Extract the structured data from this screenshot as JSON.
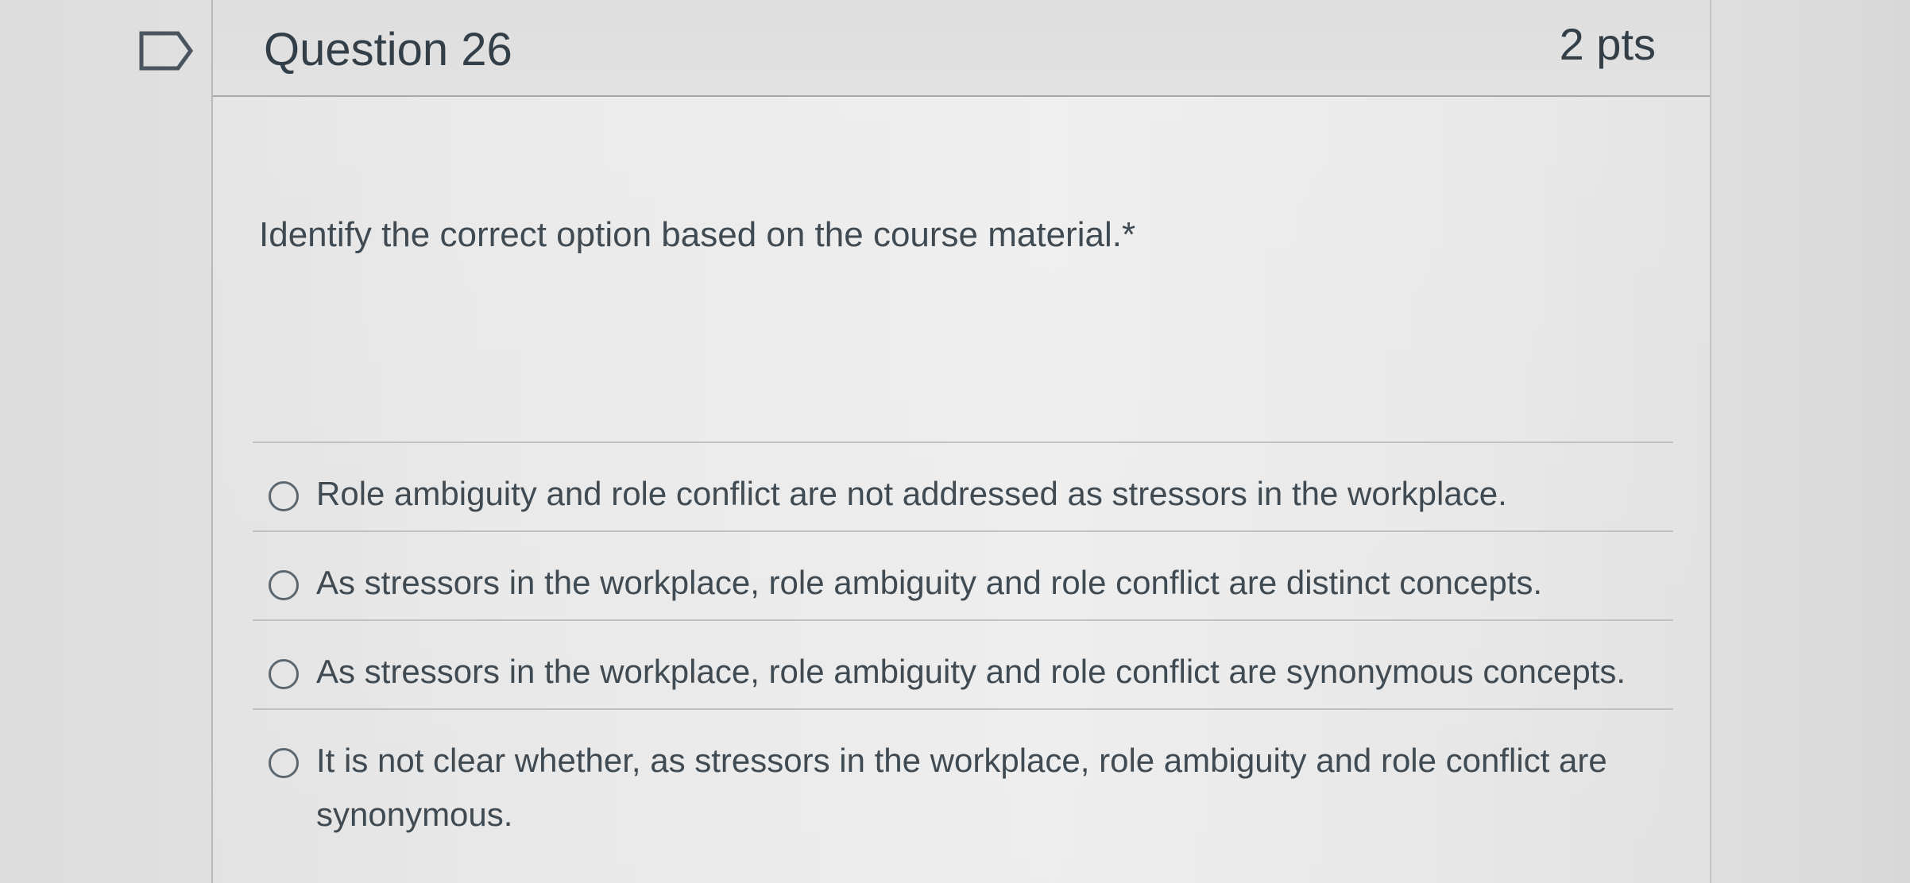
{
  "question": {
    "title": "Question 26",
    "points": "2 pts",
    "prompt": "Identify the correct option based on the course material.*",
    "flag_icon": "flag-outline-icon"
  },
  "answers": [
    {
      "label": "Role ambiguity and role conflict are not addressed as stressors in the workplace.",
      "selected": false
    },
    {
      "label": "As stressors in the workplace, role ambiguity and role conflict are distinct concepts.",
      "selected": false
    },
    {
      "label": "As stressors in the workplace, role ambiguity and role conflict are synonymous concepts.",
      "selected": false
    },
    {
      "label": "It is not clear whether, as stressors in the workplace, role ambiguity and role conflict are synonymous.",
      "selected": false
    }
  ],
  "colors": {
    "text": "#333f48",
    "border": "#b8b8b8",
    "radio": "#5b6770"
  }
}
